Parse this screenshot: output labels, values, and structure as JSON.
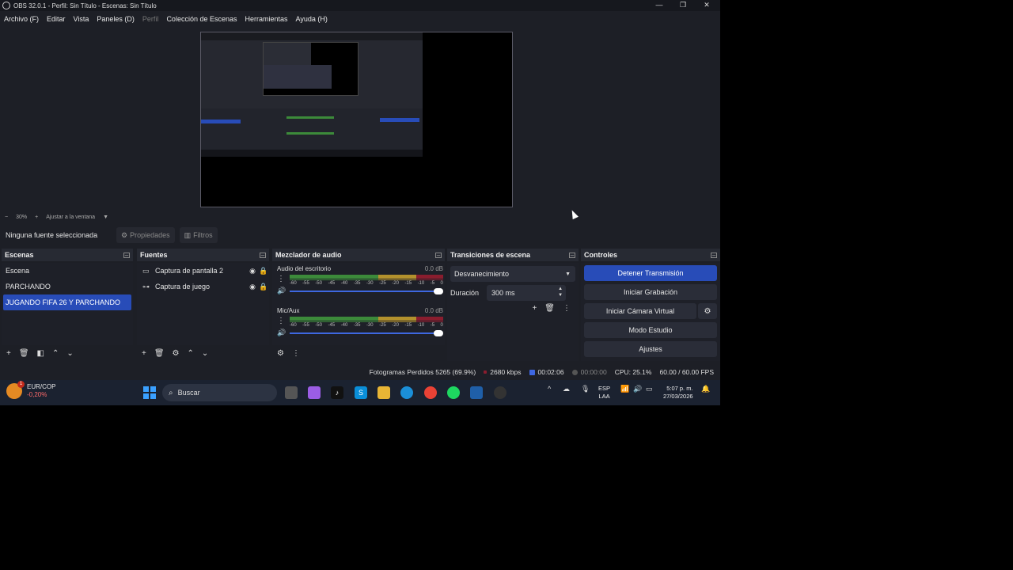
{
  "window": {
    "title": "OBS 32.0.1 - Perfil: Sin Título - Escenas: Sin Título",
    "controls": [
      "—",
      "❐",
      "✕"
    ]
  },
  "menu": [
    "Archivo (F)",
    "Editar",
    "Vista",
    "Paneles (D)",
    "Perfil",
    "Colección de Escenas",
    "Herramientas",
    "Ayuda (H)"
  ],
  "zoom": {
    "minus": "−",
    "value": "30%",
    "plus": "+",
    "fit": "Ajustar a la ventana"
  },
  "source_bar": {
    "none_selected": "Ninguna fuente seleccionada",
    "properties": "Propiedades",
    "filters": "Filtros"
  },
  "docks": {
    "scenes": {
      "title": "Escenas",
      "items": [
        "Escena",
        "PARCHANDO",
        "JUGANDO FIFA 26 Y PARCHANDO"
      ],
      "selected_index": 2
    },
    "sources": {
      "title": "Fuentes",
      "items": [
        {
          "label": "Captura de pantalla 2",
          "icon": "monitor-icon"
        },
        {
          "label": "Captura de juego",
          "icon": "gamepad-icon"
        }
      ]
    },
    "mixer": {
      "title": "Mezclador de audio",
      "channels": [
        {
          "name": "Audio del escritorio",
          "db": "0.0 dB"
        },
        {
          "name": "Mic/Aux",
          "db": "0.0 dB"
        }
      ],
      "ticks": [
        "-60",
        "-55",
        "-50",
        "-45",
        "-40",
        "-35",
        "-30",
        "-25",
        "-20",
        "-15",
        "-10",
        "-5",
        "0"
      ]
    },
    "transitions": {
      "title": "Transiciones de escena",
      "selected": "Desvanecimiento",
      "duration_label": "Duración",
      "duration_value": "300 ms"
    },
    "controls": {
      "title": "Controles",
      "buttons": [
        "Detener Transmisión",
        "Iniciar Grabación",
        "Iniciar Cámara Virtual",
        "Modo Estudio",
        "Ajustes"
      ]
    }
  },
  "status": {
    "dropped_frames": "Fotogramas Perdidos 5265 (69.9%)",
    "bitrate": "2680 kbps",
    "stream_time": "00:02:06",
    "record_time": "00:00:00",
    "cpu": "CPU: 25.1%",
    "fps": "60.00 / 60.00 FPS"
  },
  "taskbar": {
    "ticker": "EUR/COP",
    "ticker_change": "-0,20%",
    "ticker_badge": "1",
    "search": "Buscar",
    "language": [
      "ESP",
      "LAA"
    ],
    "time": "5:07 p. m.",
    "date": "27/03/2026"
  },
  "colors": {
    "accent": "#284cb8",
    "panel": "#1d1f26",
    "meter_green": "#3c8a3a",
    "meter_yellow": "#b3912d",
    "meter_red": "#8a1d2e"
  }
}
